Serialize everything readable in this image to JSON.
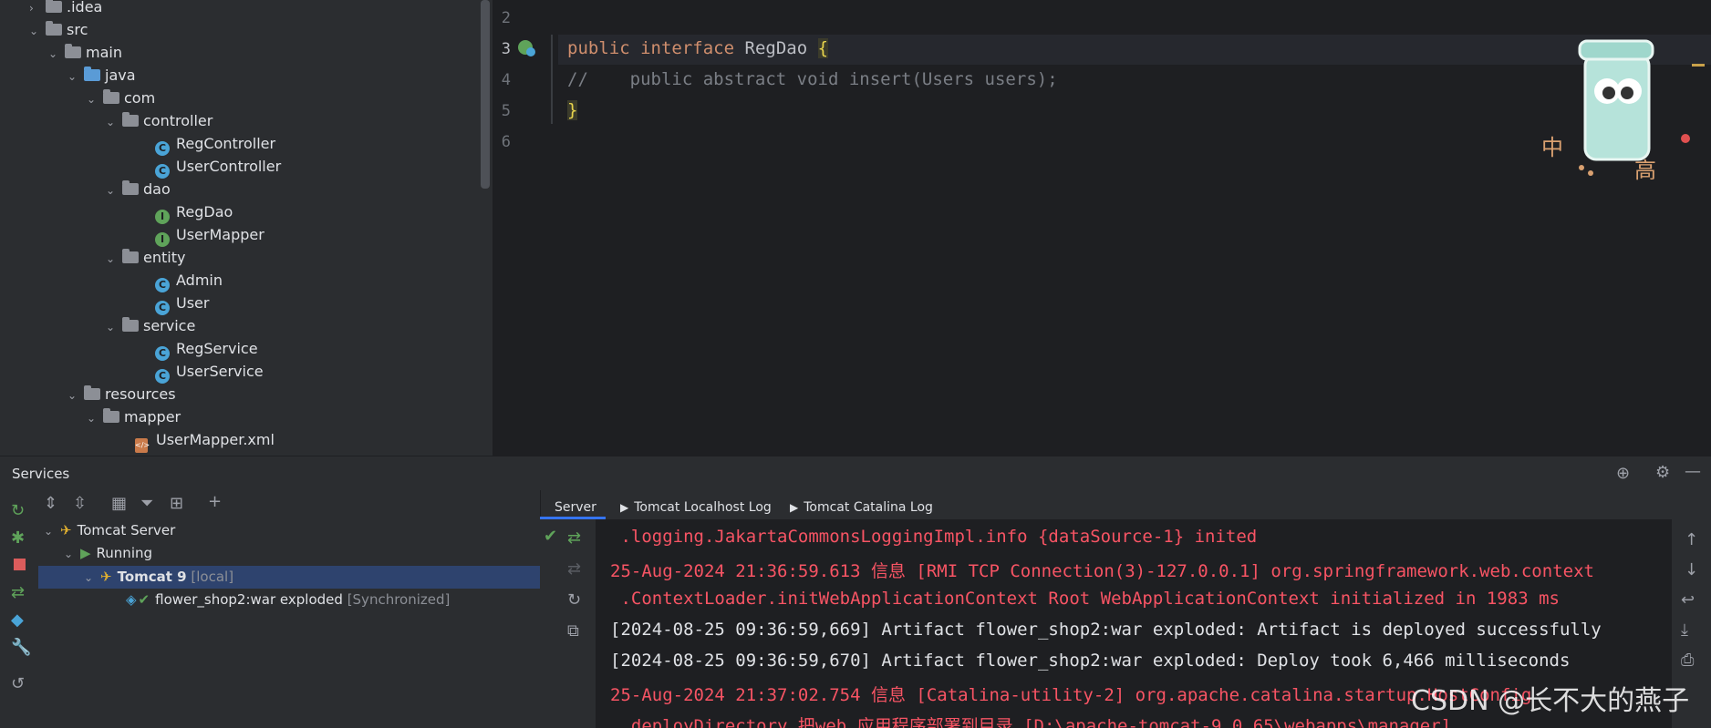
{
  "project_tree": [
    {
      "label": ".idea",
      "type": "folder",
      "expanded": false,
      "depth": 0
    },
    {
      "label": "src",
      "type": "folder",
      "expanded": true,
      "depth": 0
    },
    {
      "label": "main",
      "type": "folder",
      "expanded": true,
      "depth": 1
    },
    {
      "label": "java",
      "type": "folder-source",
      "expanded": true,
      "depth": 2
    },
    {
      "label": "com",
      "type": "package",
      "expanded": true,
      "depth": 3
    },
    {
      "label": "controller",
      "type": "package",
      "expanded": true,
      "depth": 4
    },
    {
      "label": "RegController",
      "type": "class",
      "depth": 5
    },
    {
      "label": "UserController",
      "type": "class",
      "depth": 5
    },
    {
      "label": "dao",
      "type": "package",
      "expanded": true,
      "depth": 4
    },
    {
      "label": "RegDao",
      "type": "interface",
      "depth": 5
    },
    {
      "label": "UserMapper",
      "type": "interface",
      "depth": 5
    },
    {
      "label": "entity",
      "type": "package",
      "expanded": true,
      "depth": 4
    },
    {
      "label": "Admin",
      "type": "class",
      "depth": 5
    },
    {
      "label": "User",
      "type": "class",
      "depth": 5
    },
    {
      "label": "service",
      "type": "package",
      "expanded": true,
      "depth": 4
    },
    {
      "label": "RegService",
      "type": "class",
      "depth": 5
    },
    {
      "label": "UserService",
      "type": "class",
      "depth": 5
    },
    {
      "label": "resources",
      "type": "folder-resources",
      "expanded": true,
      "depth": 2
    },
    {
      "label": "mapper",
      "type": "folder",
      "expanded": true,
      "depth": 3
    },
    {
      "label": "UserMapper.xml",
      "type": "xml",
      "depth": 4
    }
  ],
  "editor": {
    "lines": [
      {
        "num": "2",
        "text": ""
      },
      {
        "num": "3",
        "kw1": "public",
        "kw2": "interface",
        "name": "RegDao",
        "brace": "{"
      },
      {
        "num": "4",
        "comment": "//    public abstract void insert(Users users);"
      },
      {
        "num": "5",
        "brace": "}"
      },
      {
        "num": "6",
        "text": ""
      }
    ]
  },
  "services": {
    "title": "Services",
    "tree": [
      {
        "label": "Tomcat Server",
        "extra": ""
      },
      {
        "label": "Running",
        "extra": ""
      },
      {
        "label": "Tomcat 9",
        "extra": "[local]"
      },
      {
        "label": "flower_shop2:war exploded",
        "extra": "[Synchronized]"
      }
    ],
    "tabs": [
      "Server",
      "Tomcat Localhost Log",
      "Tomcat Catalina Log"
    ],
    "console": [
      {
        "text": " .logging.JakartaCommonsLoggingImpl.info {dataSource-1} inited",
        "color": "red"
      },
      {
        "text": "25-Aug-2024 21:36:59.613 信息 [RMI TCP Connection(3)-127.0.0.1] org.springframework.web.context",
        "color": "red"
      },
      {
        "text": " .ContextLoader.initWebApplicationContext Root WebApplicationContext initialized in 1983 ms",
        "color": "red"
      },
      {
        "text": "[2024-08-25 09:36:59,669] Artifact flower_shop2:war exploded: Artifact is deployed successfully",
        "color": "white"
      },
      {
        "text": "[2024-08-25 09:36:59,670] Artifact flower_shop2:war exploded: Deploy took 6,466 milliseconds",
        "color": "white"
      },
      {
        "text": "25-Aug-2024 21:37:02.754 信息 [Catalina-utility-2] org.apache.catalina.startup.HostConfig",
        "color": "red"
      },
      {
        "text": " .deployDirectory 把web 应用程序部署到目录 [D:\\apache-tomcat-9.0.65\\webapps\\manager]",
        "color": "red"
      }
    ]
  },
  "watermark": "CSDN @长不大的燕子",
  "colors": {
    "accent_red": "#f75464",
    "keyword": "#cf8e6d",
    "selection": "#2e436e"
  }
}
